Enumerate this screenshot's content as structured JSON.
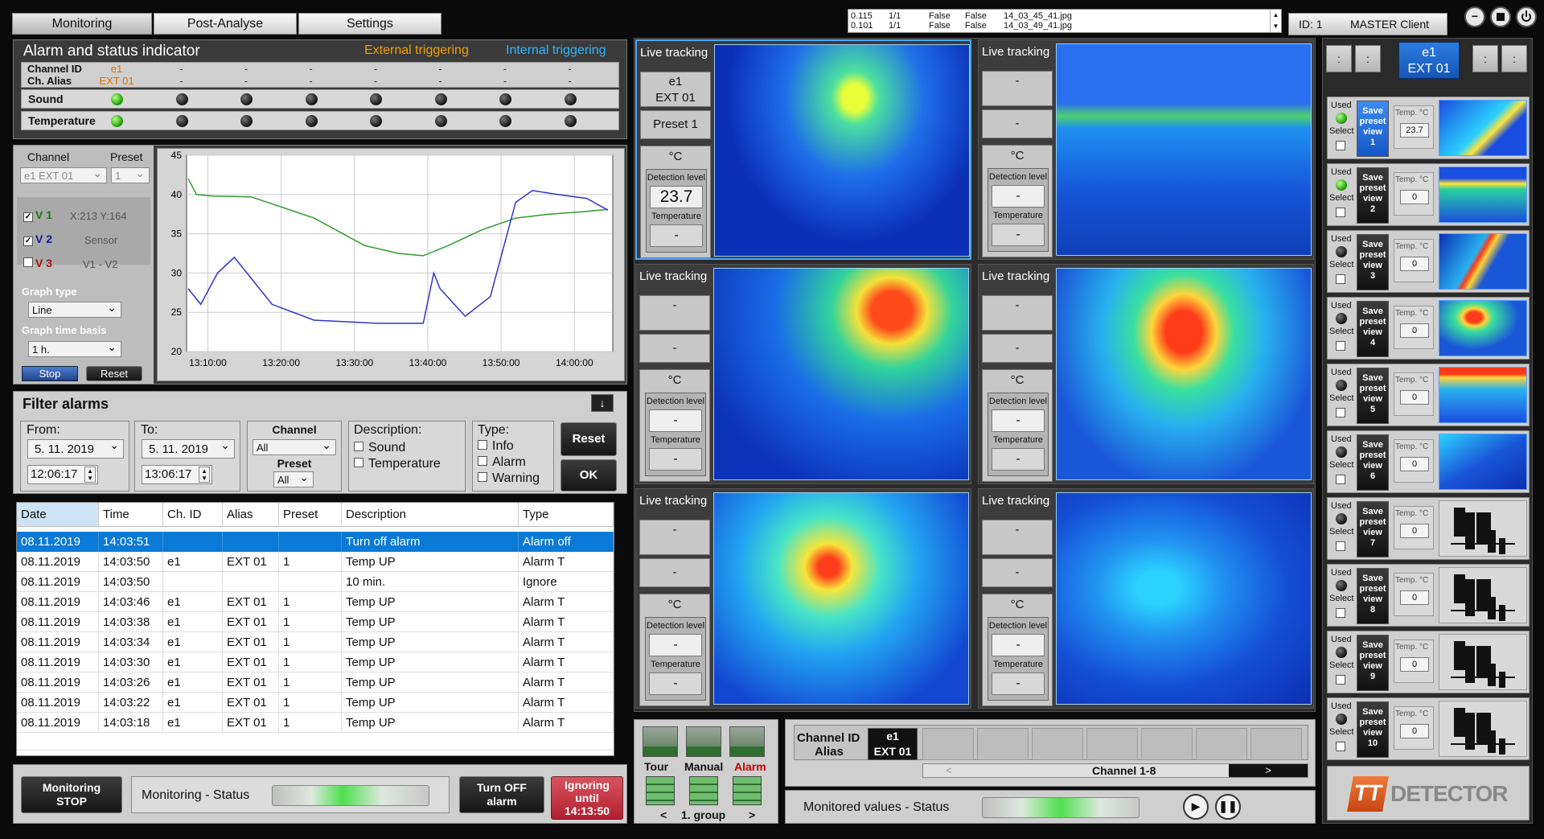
{
  "tabs": [
    {
      "label": "Monitoring"
    },
    {
      "label": "Post-Analyse"
    },
    {
      "label": "Settings"
    }
  ],
  "log_lines": [
    {
      "a": "0.115",
      "b": "1/1",
      "c": "False",
      "d": "False",
      "e": "14_03_45_41.jpg"
    },
    {
      "a": "0.101",
      "b": "1/1",
      "c": "False",
      "d": "False",
      "e": "14_03_49_41.jpg"
    }
  ],
  "client": {
    "id": "ID: 1",
    "name": "MASTER Client"
  },
  "alarm_panel": {
    "title": "Alarm and status indicator",
    "external": "External triggering",
    "internal": "Internal triggering",
    "channel_id_label": "Channel ID",
    "alias_label": "Ch. Alias",
    "channel_ids": [
      "e1",
      "-",
      "-",
      "-",
      "-",
      "-",
      "-",
      "-"
    ],
    "aliases": [
      "EXT 01",
      "-",
      "-",
      "-",
      "-",
      "-",
      "-",
      "-"
    ],
    "sound_label": "Sound",
    "temperature_label": "Temperature"
  },
  "graph_panel": {
    "channel_label": "Channel",
    "preset_label": "Preset",
    "channel_value": "e1   EXT 01",
    "preset_value": "1",
    "v1": "V 1",
    "v2": "V 2",
    "v3": "V 3",
    "coord": "X:213 Y:164",
    "sensor": "Sensor",
    "diff": "V1 - V2",
    "graph_type_label": "Graph type",
    "graph_type": "Line",
    "time_basis_label": "Graph time basis",
    "time_basis": "1 h.",
    "stop": "Stop",
    "reset": "Reset"
  },
  "chart_data": {
    "type": "line",
    "x_ticks": [
      "13:10:00",
      "13:20:00",
      "13:30:00",
      "13:40:00",
      "13:50:00",
      "14:00:00"
    ],
    "ylim": [
      20,
      45
    ],
    "y_ticks": [
      "45",
      "40",
      "35",
      "30",
      "25",
      "20"
    ],
    "grid": true,
    "series": [
      {
        "color": "#2e9b2e",
        "x": [
          0,
          0.02,
          0.06,
          0.15,
          0.3,
          0.42,
          0.5,
          0.56,
          0.62,
          0.7,
          0.78,
          0.86,
          0.94,
          1.0
        ],
        "y": [
          42,
          40,
          39.8,
          39.7,
          37,
          33.5,
          32.5,
          32.2,
          33.5,
          35.5,
          37,
          37.5,
          37.8,
          38.1
        ]
      },
      {
        "color": "#3333cc",
        "x": [
          0,
          0.03,
          0.07,
          0.11,
          0.14,
          0.2,
          0.3,
          0.45,
          0.56,
          0.585,
          0.6,
          0.66,
          0.72,
          0.75,
          0.78,
          0.82,
          0.88,
          0.95,
          1.0
        ],
        "y": [
          28,
          26,
          30,
          32,
          30,
          26,
          24,
          23.6,
          23.6,
          30,
          28,
          24.5,
          27,
          33,
          39,
          40.5,
          40,
          39.5,
          38
        ]
      }
    ]
  },
  "filter": {
    "title": "Filter alarms",
    "from_label": "From:",
    "to_label": "To:",
    "from_date": "5. 11. 2019",
    "from_time": "12:06:17",
    "to_date": "5. 11. 2019",
    "to_time": "13:06:17",
    "channel_label": "Channel",
    "channel_value": "All",
    "preset_label": "Preset",
    "preset_value": "All",
    "description_label": "Description:",
    "desc_opts": [
      "Sound",
      "Temperature"
    ],
    "type_label": "Type:",
    "type_opts": [
      "Info",
      "Alarm",
      "Warning"
    ],
    "reset": "Reset",
    "ok": "OK"
  },
  "alarm_table": {
    "headers": [
      "Date",
      "Time",
      "Ch. ID",
      "Alias",
      "Preset",
      "Description",
      "Type"
    ],
    "rows": [
      [
        "08.11.2019",
        "14:03:51",
        "",
        "",
        "",
        "Turn off alarm",
        "Alarm off"
      ],
      [
        "08.11.2019",
        "14:03:50",
        "e1",
        "EXT 01",
        "1",
        "Temp UP",
        "Alarm T"
      ],
      [
        "08.11.2019",
        "14:03:50",
        "",
        "",
        "",
        "10 min.",
        "Ignore"
      ],
      [
        "08.11.2019",
        "14:03:46",
        "e1",
        "EXT 01",
        "1",
        "Temp UP",
        "Alarm T"
      ],
      [
        "08.11.2019",
        "14:03:38",
        "e1",
        "EXT 01",
        "1",
        "Temp UP",
        "Alarm T"
      ],
      [
        "08.11.2019",
        "14:03:34",
        "e1",
        "EXT 01",
        "1",
        "Temp UP",
        "Alarm T"
      ],
      [
        "08.11.2019",
        "14:03:30",
        "e1",
        "EXT 01",
        "1",
        "Temp UP",
        "Alarm T"
      ],
      [
        "08.11.2019",
        "14:03:26",
        "e1",
        "EXT 01",
        "1",
        "Temp UP",
        "Alarm T"
      ],
      [
        "08.11.2019",
        "14:03:22",
        "e1",
        "EXT 01",
        "1",
        "Temp UP",
        "Alarm T"
      ],
      [
        "08.11.2019",
        "14:03:18",
        "e1",
        "EXT 01",
        "1",
        "Temp UP",
        "Alarm T"
      ]
    ]
  },
  "bottom_left": {
    "monitoring_stop_1": "Monitoring",
    "monitoring_stop_2": "STOP",
    "status_label": "Monitoring - Status",
    "turn_off_1": "Turn OFF",
    "turn_off_2": "alarm",
    "ignoring_1": "Ignoring",
    "ignoring_2": "until",
    "ignoring_3": "14:13:50"
  },
  "live": {
    "label": "Live tracking",
    "unit": "°C",
    "detection": "Detection level",
    "temperature": "Temperature",
    "cells": [
      {
        "ch": "e1",
        "alias": "EXT 01",
        "preset": "Preset 1",
        "value": "23.7",
        "temp": "-"
      },
      {
        "ch": "-",
        "alias": "",
        "preset": "-",
        "value": "-",
        "temp": "-"
      },
      {
        "ch": "-",
        "alias": "",
        "preset": "-",
        "value": "-",
        "temp": "-"
      },
      {
        "ch": "-",
        "alias": "",
        "preset": "-",
        "value": "-",
        "temp": "-"
      },
      {
        "ch": "-",
        "alias": "",
        "preset": "-",
        "value": "-",
        "temp": "-"
      },
      {
        "ch": "-",
        "alias": "",
        "preset": "-",
        "value": "-",
        "temp": "-"
      }
    ]
  },
  "mode": {
    "tour": "Tour",
    "manual": "Manual",
    "alarm": "Alarm",
    "group": "1. group",
    "prev": "<",
    "next": ">"
  },
  "channel_strip": {
    "id_label": "Channel ID",
    "alias_label": "Alias",
    "ch": "e1",
    "alias": "EXT 01",
    "range": "Channel 1-8",
    "arrow_l": "<",
    "arrow_r": ">"
  },
  "monitored_status": "Monitored values - Status",
  "right": {
    "selected_ch": "e1",
    "selected_alias": "EXT 01",
    "nav": ":",
    "used": "Used",
    "select": "Select",
    "temp_label": "Temp. °C",
    "save_1": "Save",
    "save_2": "preset",
    "save_3": "view",
    "presets": [
      {
        "n": "1",
        "temp": "23.7"
      },
      {
        "n": "2",
        "temp": "0"
      },
      {
        "n": "3",
        "temp": "0"
      },
      {
        "n": "4",
        "temp": "0"
      },
      {
        "n": "5",
        "temp": "0"
      },
      {
        "n": "6",
        "temp": "0"
      },
      {
        "n": "7",
        "temp": "0"
      },
      {
        "n": "8",
        "temp": "0"
      },
      {
        "n": "9",
        "temp": "0"
      },
      {
        "n": "10",
        "temp": "0"
      }
    ],
    "logo_tt": "TT",
    "logo_text": "DETECTOR"
  }
}
